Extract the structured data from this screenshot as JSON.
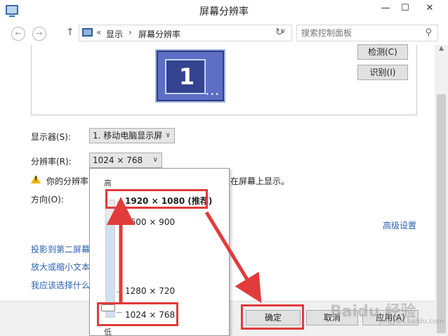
{
  "window": {
    "title": "屏幕分辨率",
    "minimize_glyph": "—",
    "maximize_glyph": "☐",
    "close_glyph": "✕"
  },
  "address_bar": {
    "back_glyph": "←",
    "forward_glyph": "→",
    "up_glyph": "↑",
    "prefix": "«",
    "breadcrumb": [
      "显示",
      "屏幕分辨率"
    ],
    "separator": "›",
    "dropdown_glyph": "∨",
    "refresh_glyph": "↻",
    "search_placeholder": "搜索控制面板",
    "search_glyph": "⚲"
  },
  "preview": {
    "monitor_number": "1",
    "monitor_dots": "•••",
    "detect_label": "检测(C)",
    "identify_label": "识别(I)"
  },
  "settings": {
    "display_label": "显示器(S):",
    "display_value": "1. 移动电脑显示屏",
    "resolution_label": "分辨率(R):",
    "resolution_value": "1024 × 768",
    "warning_text_before": "你的分辨率",
    "warning_text_after": "在屏幕上显示。",
    "orientation_label": "方向(O):",
    "advanced_link": "高级设置",
    "dropdown_glyph": "∨"
  },
  "links": [
    "投影到第二屏幕",
    "放大或缩小文本",
    "我应该选择什么"
  ],
  "footer": {
    "ok_label": "确定",
    "cancel_label": "取消",
    "apply_label": "应用(A)"
  },
  "resolution_popup": {
    "high_label": "高",
    "low_label": "低",
    "options": [
      "1920 × 1080 (推荐)",
      "1600 × 900",
      "1280 × 720",
      "1024 × 768"
    ],
    "recommended": "1920 × 1080 (推荐)",
    "selected": "1024 × 768"
  },
  "annotation": {
    "color": "#e23b3b"
  },
  "watermark": {
    "text": "Baidu 经验",
    "sub": "jingyan.baidu.com"
  }
}
